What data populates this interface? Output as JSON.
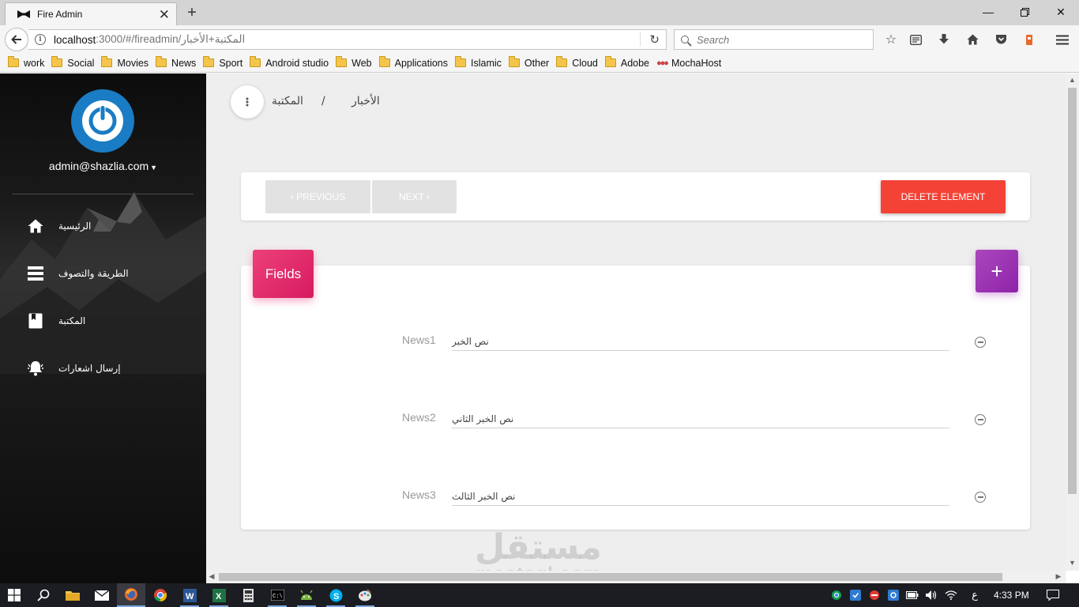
{
  "browser": {
    "tab_title": "Fire Admin",
    "new_tab": "+",
    "url_host": "localhost",
    "url_rest": ":3000/#/fireadmin/المكتبة+الأخبار",
    "search_placeholder": "Search",
    "bookmarks": [
      "work",
      "Social",
      "Movies",
      "News",
      "Sport",
      "Android studio",
      "Web",
      "Applications",
      "Islamic",
      "Other",
      "Cloud",
      "Adobe",
      "MochaHost"
    ]
  },
  "sidebar": {
    "email": "admin@shazlia.com",
    "items": [
      {
        "label": "الرئيسية",
        "icon": "home-icon"
      },
      {
        "label": "الطريقة والتصوف",
        "icon": "list-icon"
      },
      {
        "label": "المكتبة",
        "icon": "book-icon"
      },
      {
        "label": "إرسال اشعارات",
        "icon": "bell-icon"
      }
    ]
  },
  "breadcrumb": {
    "items": [
      "المكتبة",
      "الأخبار"
    ],
    "separator": "/"
  },
  "nav_card": {
    "previous_label": "‹ PREVIOUS",
    "next_label": "NEXT ›",
    "delete_label": "DELETE ELEMENT"
  },
  "fields_card": {
    "title": "Fields",
    "add_label": "+",
    "fields": [
      {
        "label": "News1",
        "value": "نص الخبر"
      },
      {
        "label": "News2",
        "value": "نص الخبر الثاني"
      },
      {
        "label": "News3",
        "value": "نص الخبر الثالث"
      }
    ]
  },
  "watermark": {
    "arabic": "مستقل",
    "latin": "mostaql.com"
  },
  "taskbar": {
    "clock": "4:33 PM",
    "lang": "ع"
  },
  "colors": {
    "delete": "#f44336",
    "fields_badge": "#e91e63",
    "add_button": "#9c27b0",
    "avatar": "#1a7cc4"
  }
}
